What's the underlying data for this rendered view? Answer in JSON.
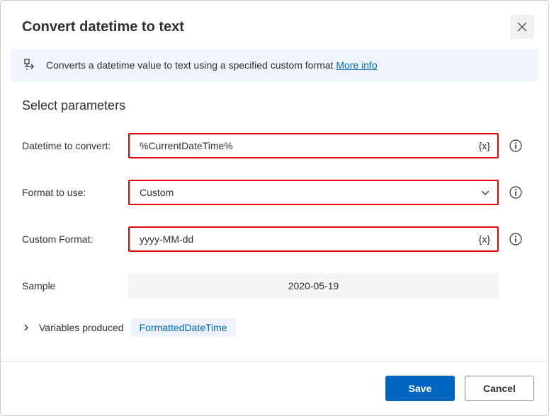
{
  "header": {
    "title": "Convert datetime to text"
  },
  "infoBanner": {
    "text": "Converts a datetime value to text using a specified custom format ",
    "linkText": "More info"
  },
  "section": {
    "title": "Select parameters"
  },
  "rows": {
    "datetime": {
      "label": "Datetime to convert:",
      "value": "%CurrentDateTime%",
      "suffix": "{x}"
    },
    "format": {
      "label": "Format to use:",
      "value": "Custom"
    },
    "custom": {
      "label": "Custom Format:",
      "value": "yyyy-MM-dd",
      "suffix": "{x}"
    },
    "sample": {
      "label": "Sample",
      "value": "2020-05-19"
    }
  },
  "variables": {
    "label": "Variables produced",
    "badge": "FormattedDateTime"
  },
  "footer": {
    "save": "Save",
    "cancel": "Cancel"
  }
}
